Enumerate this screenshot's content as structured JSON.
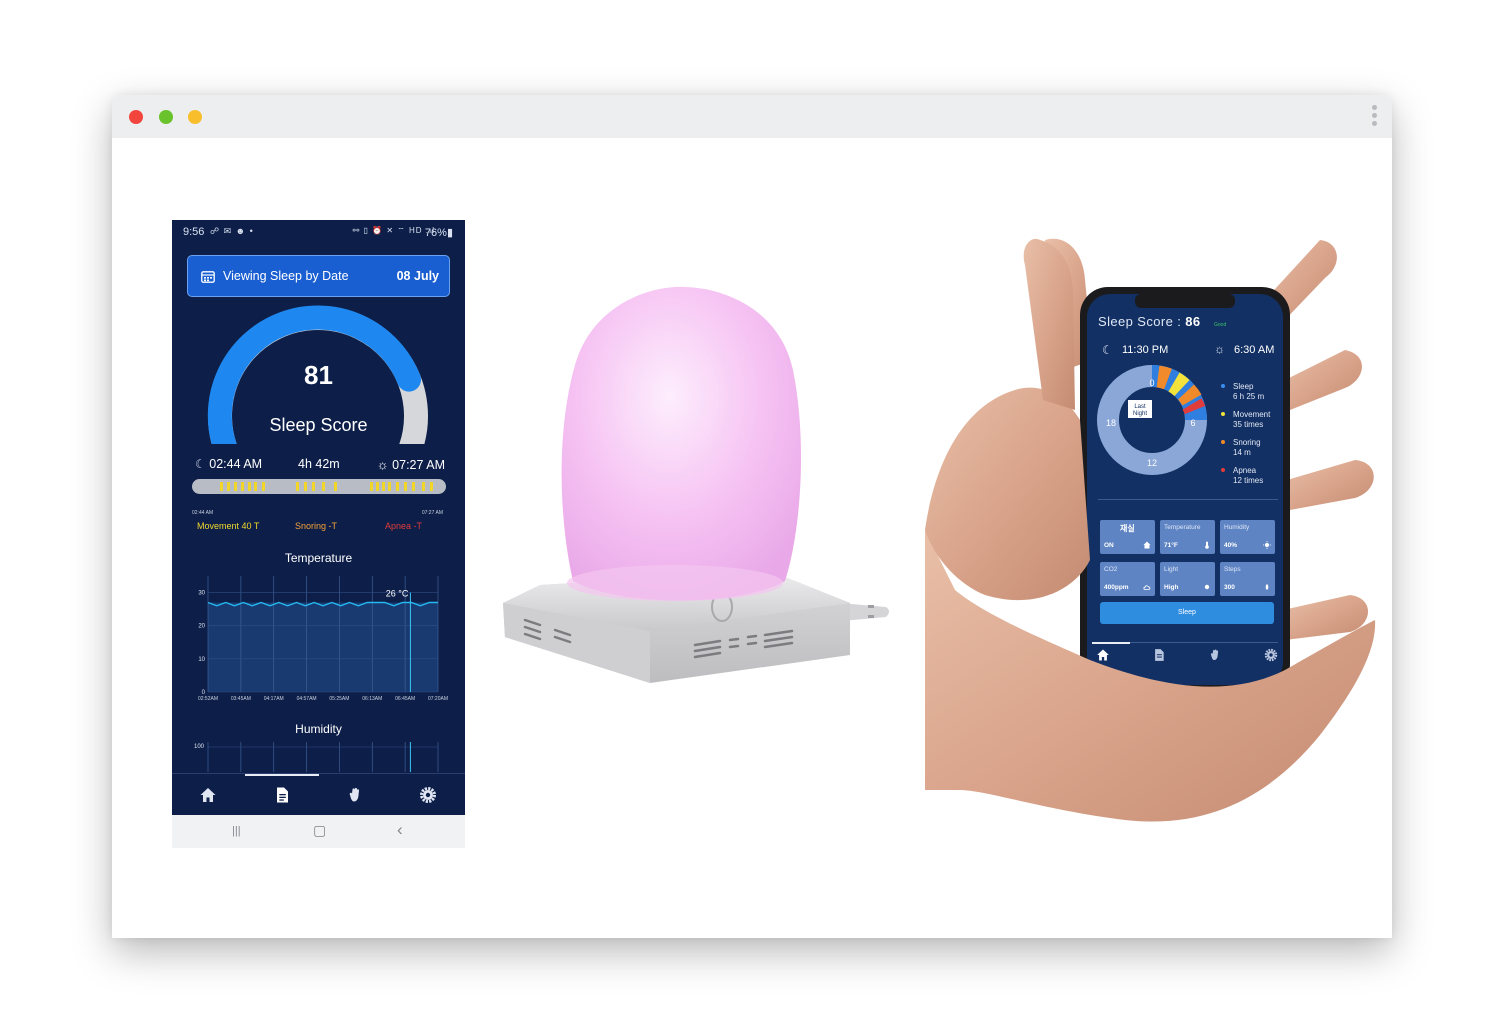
{
  "window": {
    "controls": [
      "close",
      "minimize",
      "maximize"
    ],
    "menu_icon": "kebab-icon"
  },
  "phone1": {
    "status": {
      "time": "9:56",
      "left_icons": "☍ ✉ ☻ •",
      "right_icons": "⚯ ▯ ⏰ ✕ ⌔ HD .ıl",
      "battery": "76%▮"
    },
    "date_card": {
      "label": "Viewing Sleep by Date",
      "value": "08 July",
      "icon": "calendar-icon"
    },
    "score": {
      "value": "81",
      "label": "Sleep Score",
      "gauge_fraction": 0.81,
      "gauge_color": "#1e88f0",
      "track_color": "#d6d7da"
    },
    "times": {
      "bed_time": "02:44 AM",
      "duration": "4h 42m",
      "wake_time": "07:27 AM",
      "track_start": "02:44 AM",
      "track_end": "07:27 AM"
    },
    "legend": {
      "movement": "Movement  40 T",
      "snoring": "Snoring -T",
      "apnea": "Apnea -T"
    },
    "temperature": {
      "title": "Temperature",
      "current_label": "26 °C"
    },
    "humidity": {
      "title": "Humidity"
    },
    "nav": [
      "home-icon",
      "document-icon",
      "hand-icon",
      "gear-icon"
    ],
    "android_nav": {
      "recents": "|||",
      "home": "▢",
      "back": "‹"
    }
  },
  "phone2": {
    "title_prefix": "Sleep Score : ",
    "score": "86",
    "score_rating": "Good",
    "bed_time": "11:30 PM",
    "wake_time": "6:30 AM",
    "donut": {
      "center_label_1": "Last",
      "center_label_2": "Night",
      "hour_0": "0",
      "hour_6": "6",
      "hour_12": "12",
      "hour_18": "18"
    },
    "stats": [
      {
        "title": "Sleep",
        "value": "6 h 25 m",
        "color": "#3b8ef0"
      },
      {
        "title": "Movement",
        "value": "35 times",
        "color": "#f2e23b"
      },
      {
        "title": "Snoring",
        "value": "14 m",
        "color": "#f08a2a"
      },
      {
        "title": "Apnea",
        "value": "12 times",
        "color": "#e23b3b"
      }
    ],
    "tiles": [
      {
        "title": "재실",
        "value": "ON"
      },
      {
        "title": "Temperature",
        "value": "71°F"
      },
      {
        "title": "Humidity",
        "value": "40%"
      },
      {
        "title": "CO2",
        "value": "400ppm"
      },
      {
        "title": "Light",
        "value": "High"
      },
      {
        "title": "Steps",
        "value": "300"
      }
    ],
    "sleep_button": "Sleep"
  },
  "chart_data": [
    {
      "type": "line",
      "title": "Temperature",
      "x": [
        "02:52AM",
        "03:45AM",
        "04:17AM",
        "04:57AM",
        "05:25AM",
        "06:13AM",
        "06:45AM",
        "07:20AM"
      ],
      "yticks": [
        "0",
        "10",
        "20",
        "30"
      ],
      "ylim": [
        0,
        35
      ],
      "series": [
        {
          "values": [
            27,
            26,
            27,
            26,
            27,
            26,
            27,
            26,
            27,
            26,
            27,
            26,
            27,
            26,
            27,
            26,
            27,
            26,
            27,
            27,
            27,
            26,
            27,
            27,
            26,
            27,
            27
          ]
        }
      ],
      "annotation": "26 °C",
      "grid": true,
      "line_color": "#25b8f0"
    },
    {
      "type": "line",
      "title": "Humidity",
      "yticks": [
        "100"
      ],
      "ylim": [
        0,
        100
      ],
      "grid": true
    }
  ]
}
